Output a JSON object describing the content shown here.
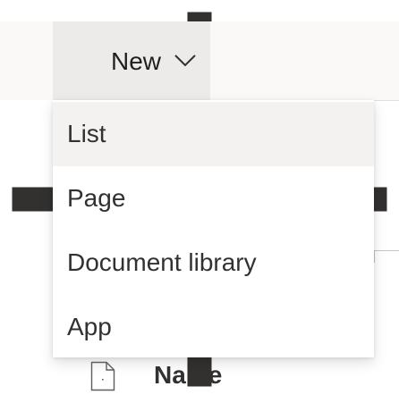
{
  "command_bar": {
    "new_label": "New"
  },
  "new_menu": {
    "items": [
      {
        "label": "List",
        "hovered": true
      },
      {
        "label": "Page",
        "hovered": false
      },
      {
        "label": "Document library",
        "hovered": false
      },
      {
        "label": "App",
        "hovered": false
      }
    ]
  },
  "list_header": {
    "name_column": "Name"
  },
  "icons": {
    "new": "plus-icon",
    "dropdown": "chevron-down-icon",
    "file_type": "document-icon"
  }
}
